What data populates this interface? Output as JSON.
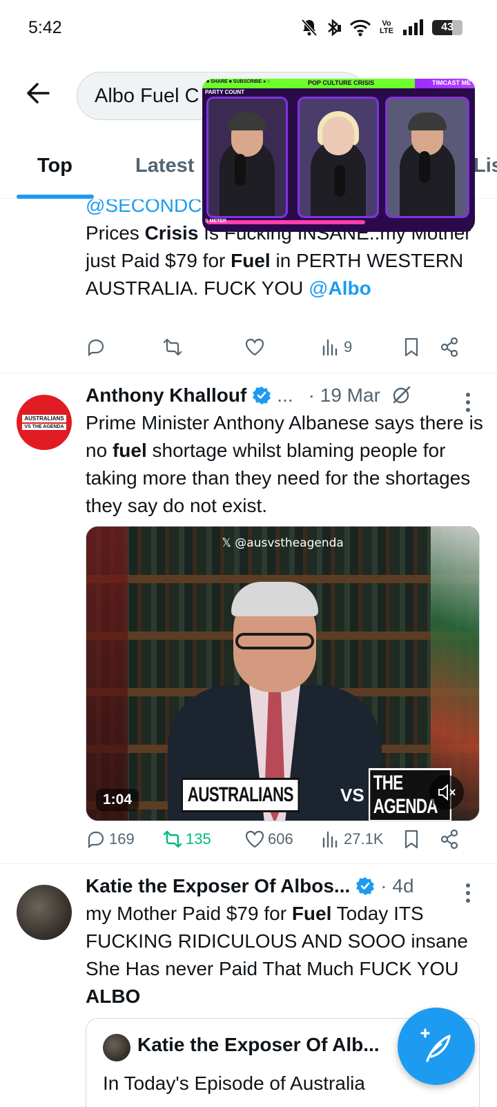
{
  "status_bar": {
    "time": "5:42",
    "battery": "43",
    "network": "Vo LTE",
    "icons": [
      "bell-muted-icon",
      "bluetooth-icon",
      "wifi-icon",
      "signal-icon",
      "battery-icon"
    ]
  },
  "search": {
    "value": "Albo Fuel C"
  },
  "tabs": {
    "top": "Top",
    "latest": "Latest",
    "lists": "Lis",
    "active": "top"
  },
  "pip_overlay": {
    "show_title": "POP CULTURE CRISIS",
    "channel": "TIMCAST ME",
    "party_label": "PARTY COUNT",
    "meter_label": "S METER"
  },
  "tweets": [
    {
      "mention_top": "@SECONDC",
      "text_parts": [
        {
          "t": "Prices ",
          "b": false
        },
        {
          "t": "Crisis",
          "b": true
        },
        {
          "t": " Is Fucking INSANE..my Mother just Paid $79 for ",
          "b": false
        },
        {
          "t": "Fuel",
          "b": true
        },
        {
          "t": " in PERTH WESTERN AUSTRALIA. FUCK YOU ",
          "b": false
        }
      ],
      "mention_end_at": "@",
      "mention_end_name": "Albo",
      "stats": {
        "reply": "",
        "retweet": "",
        "like": "",
        "views": "9"
      }
    },
    {
      "author": "Anthony Khallouf",
      "handle_trunc": "...",
      "time": "· 19 Mar",
      "avatar_text": [
        "AUSTRALIANS",
        "VS",
        "THE AGENDA"
      ],
      "text_parts": [
        {
          "t": "Prime Minister Anthony Albanese says there is no ",
          "b": false
        },
        {
          "t": "fuel",
          "b": true
        },
        {
          "t": " shortage whilst blaming people for taking more than they need for the shortages they say do not exist.",
          "b": false
        }
      ],
      "video": {
        "watermark": "𝕏 @ausvstheagenda",
        "logo_left": "AUSTRALIANS",
        "logo_vs": "VS",
        "logo_right": "THE AGENDA",
        "duration": "1:04"
      },
      "stats": {
        "reply": "169",
        "retweet": "135",
        "like": "606",
        "views": "27.1K"
      }
    },
    {
      "author": "Katie the Exposer Of Albos...",
      "time": "· 4d",
      "text_parts": [
        {
          "t": "my Mother Paid $79 for ",
          "b": false
        },
        {
          "t": "Fuel",
          "b": true
        },
        {
          "t": " Today ITS FUCKING RIDICULOUS AND SOOO insane She Has never Paid That Much FUCK YOU ",
          "b": false
        },
        {
          "t": "ALBO",
          "b": true
        }
      ],
      "quote": {
        "author": "Katie the Exposer Of Alb...",
        "text": "In Today's Episode of Australia"
      }
    }
  ],
  "colors": {
    "accent": "#1d9bf0",
    "text": "#0f1419",
    "muted": "#536471",
    "retweet_green": "#00ba7c"
  }
}
